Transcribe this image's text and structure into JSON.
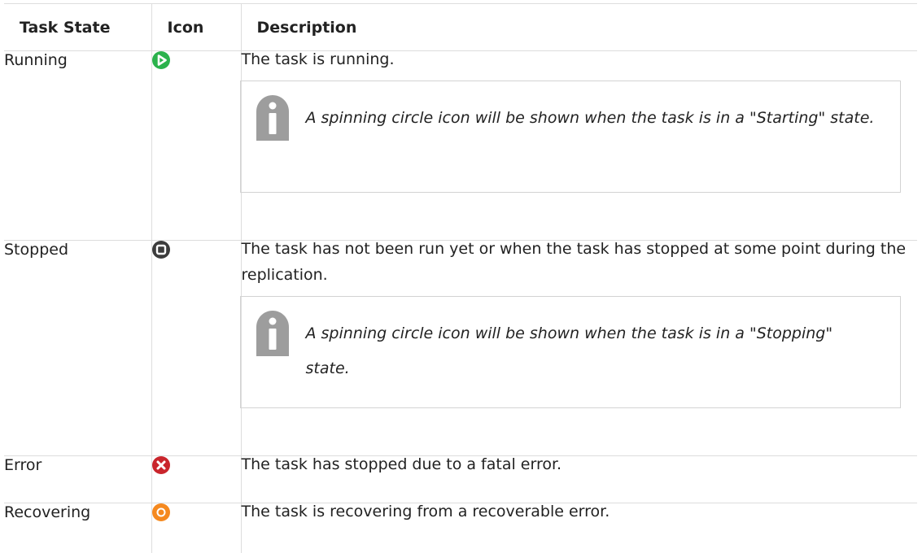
{
  "table": {
    "headers": {
      "state": "Task State",
      "icon": "Icon",
      "description": "Description"
    },
    "rows": [
      {
        "state": "Running",
        "icon": "running-play-icon",
        "icon_color": "#2bb24c",
        "description": "The task is running.",
        "note": "A spinning circle icon will be shown when the task is in a \"Starting\" state."
      },
      {
        "state": "Stopped",
        "icon": "stopped-square-icon",
        "icon_color": "#3c3c3c",
        "description": "The task has not been run yet or when the task has stopped at some point during the replication.",
        "note": "A spinning circle icon will be shown when the task is in a \"Stopping\" state."
      },
      {
        "state": "Error",
        "icon": "error-x-icon",
        "icon_color": "#c9252c",
        "description": "The task has stopped due to a fatal error."
      },
      {
        "state": "Recovering",
        "icon": "recovering-spinner-icon",
        "icon_color": "#f5891f",
        "description": "The task is recovering from a recoverable error."
      }
    ]
  },
  "colors": {
    "border": "#dddddd",
    "note_border": "#d3d3d3",
    "info_icon": "#9d9d9d",
    "text": "#222222"
  }
}
